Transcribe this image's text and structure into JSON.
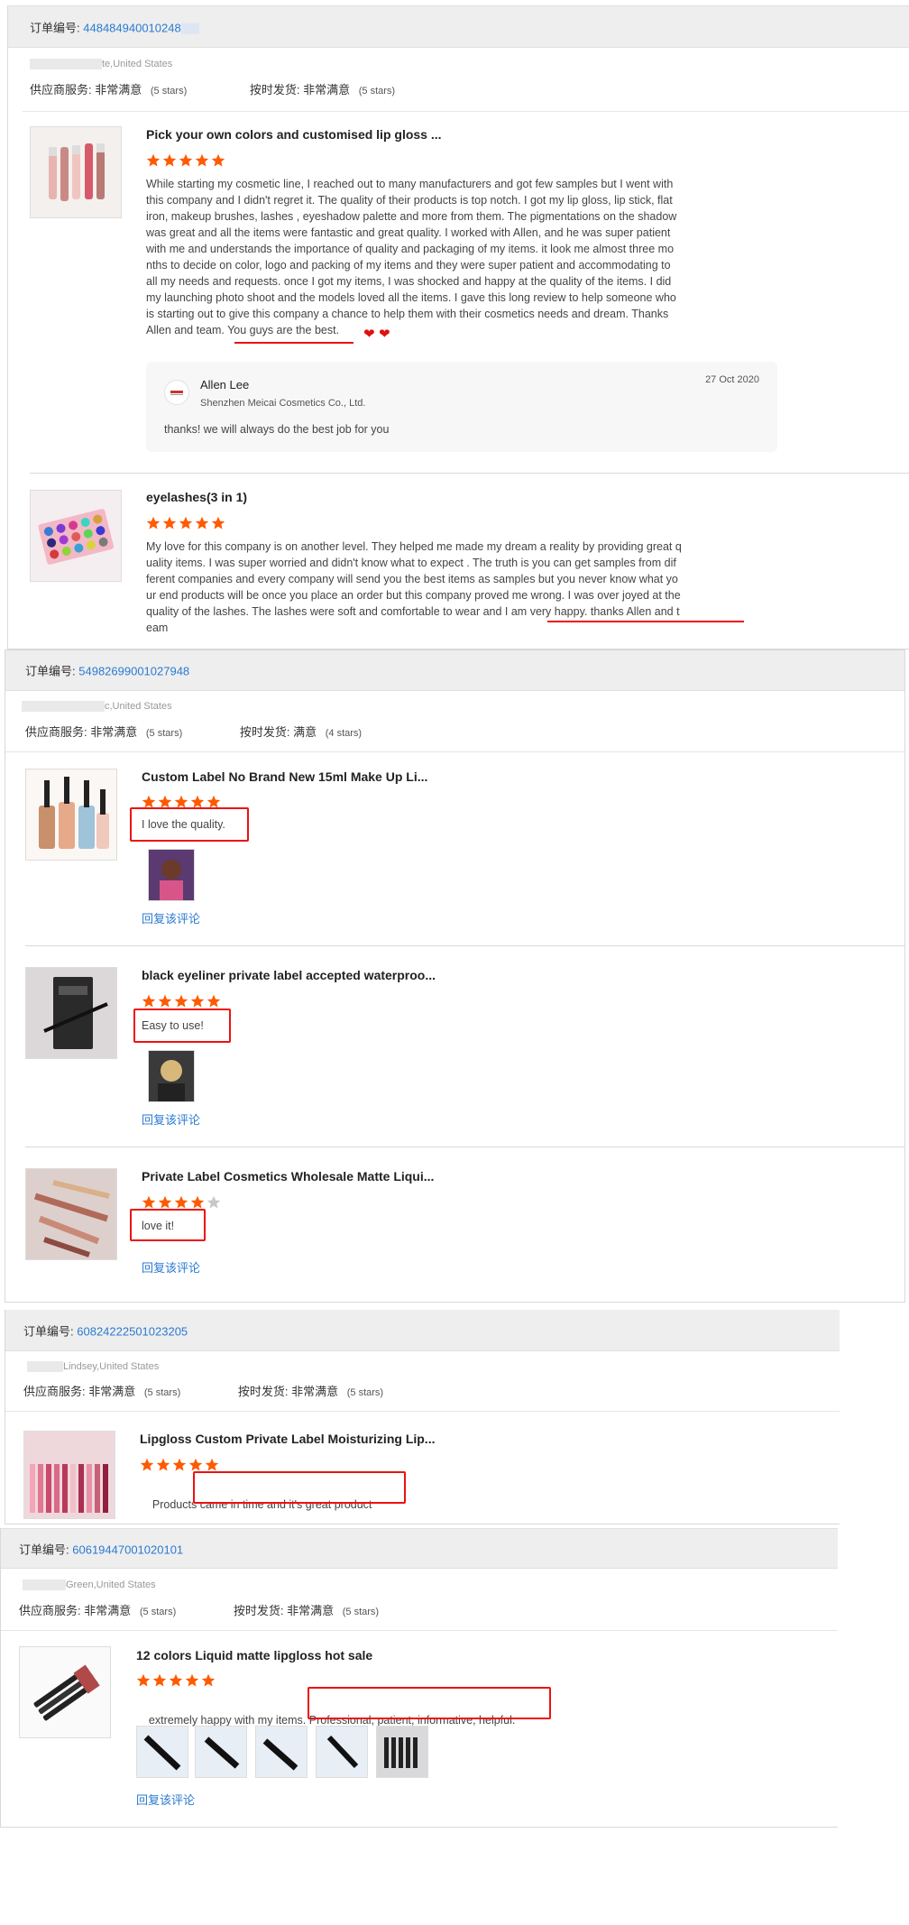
{
  "labels": {
    "order_no": "订单编号:",
    "supplier_service": "供应商服务:",
    "on_time": "按时发货:",
    "reply_link": "回复该评论"
  },
  "orders": [
    {
      "order_id": "448484940010248",
      "buyer": "te,United States",
      "supplier_value": "非常满意",
      "supplier_stars": "(5 stars)",
      "ontime_value": "非常满意",
      "ontime_stars": "(5 stars)",
      "products": [
        {
          "title": "Pick your own colors and customised lip gloss ...",
          "rating": 5,
          "lines": [
            "While starting my cosmetic line, I reached out to many manufacturers and got few samples but I went with",
            "this company and I didn't regret it. The  quality of their products is top notch. I got my lip gloss, lip stick, flat",
            "iron, makeup brushes, lashes , eyeshadow palette and more from them. The pigmentations on the shadow",
            "was great and all the items were fantastic and great quality. I worked with Allen, and he was super patient",
            "with me and understands the importance of quality and packaging of my items. it look me almost three mo",
            "nths to decide on color, logo and packing of my items and they were super patient and accommodating to",
            "all my needs and requests. once I got my items, I was shocked and happy at the quality of the items. I did",
            "my launching photo shoot and the models loved all the items. I gave this long review to help someone who",
            "is starting out to give this company a chance to help them with their cosmetics needs and dream. Thanks",
            "Allen and team. You guys are the best."
          ],
          "reply": {
            "name": "Allen Lee",
            "company": "Shenzhen Meicai Cosmetics Co., Ltd.",
            "date": "27 Oct 2020",
            "text": "thanks!  we will always do the best job for you"
          }
        },
        {
          "title": "eyelashes(3 in 1)",
          "rating": 5,
          "lines": [
            "My love for this company is on another level. They helped me made my dream a reality by providing great q",
            "uality items. I was super worried and didn't know what to expect . The truth is you can get samples from dif",
            "ferent companies and every company will send you the best items as samples but you never know what yo",
            "ur end products will be once you place an order but this company proved me wrong. I was over joyed at the",
            "quality of the lashes. The lashes were soft and comfortable to wear and I am very happy. thanks Allen and t",
            "eam"
          ]
        }
      ]
    },
    {
      "order_id": "54982699001027948",
      "buyer": "c,United States",
      "supplier_value": "非常满意",
      "supplier_stars": "(5 stars)",
      "ontime_value": "满意",
      "ontime_stars": "(4 stars)",
      "products": [
        {
          "title": "Custom Label No Brand New 15ml Make Up Li...",
          "rating": 5,
          "text": "I love the quality."
        },
        {
          "title": "black eyeliner private label accepted waterproo...",
          "rating": 5,
          "text": "Easy to use!"
        },
        {
          "title": "Private Label Cosmetics Wholesale Matte Liqui...",
          "rating": 4,
          "text": "love it!"
        }
      ]
    },
    {
      "order_id": "60824222501023205",
      "buyer": "Lindsey,United States",
      "supplier_value": "非常满意",
      "supplier_stars": "(5 stars)",
      "ontime_value": "非常满意",
      "ontime_stars": "(5 stars)",
      "products": [
        {
          "title": "Lipgloss Custom Private Label Moisturizing Lip...",
          "rating": 5,
          "text_a": "Products ",
          "text_b": "came in time and it's great product"
        }
      ]
    },
    {
      "order_id": "60619447001020101",
      "buyer": "Green,United States",
      "supplier_value": "非常满意",
      "supplier_stars": "(5 stars)",
      "ontime_value": "非常满意",
      "ontime_stars": "(5 stars)",
      "products": [
        {
          "title": "12 colors Liquid matte lipgloss hot sale",
          "rating": 5,
          "text_a": "extremely happy with my items. ",
          "text_b": "Professional, patient, informative, helpful."
        }
      ]
    }
  ],
  "colors": {
    "star": "#ff5a00",
    "star_empty": "#c8c8c8",
    "link": "#2a7ad2",
    "highlight": "#e11111"
  }
}
